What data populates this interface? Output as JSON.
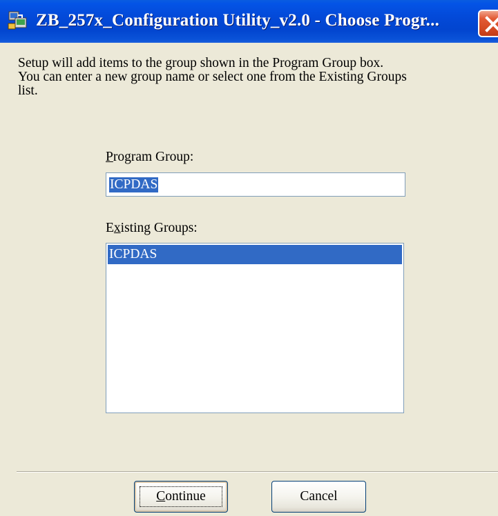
{
  "window": {
    "title": "ZB_257x_Configuration Utility_v2.0 - Choose Progr...",
    "title_icon": "setup-installer-icon",
    "close_icon": "close-icon"
  },
  "intro": {
    "text": "Setup will add items to the group shown in the Program Group box.\nYou can enter a new group name or select one from the Existing Groups\nlist."
  },
  "program_group": {
    "label_underlined": "P",
    "label_rest": "rogram Group:",
    "value": "ICPDAS"
  },
  "existing_groups": {
    "label_first": "E",
    "label_underlined": "x",
    "label_rest": "isting Groups:",
    "items": [
      "ICPDAS"
    ],
    "selected_index": 0
  },
  "buttons": {
    "continue_underlined": "C",
    "continue_rest": "ontinue",
    "cancel": "Cancel"
  },
  "colors": {
    "titlebar": "#0349d8",
    "selection": "#316ac5",
    "dialog_bg": "#ece9d8",
    "close_button": "#d54a22"
  }
}
